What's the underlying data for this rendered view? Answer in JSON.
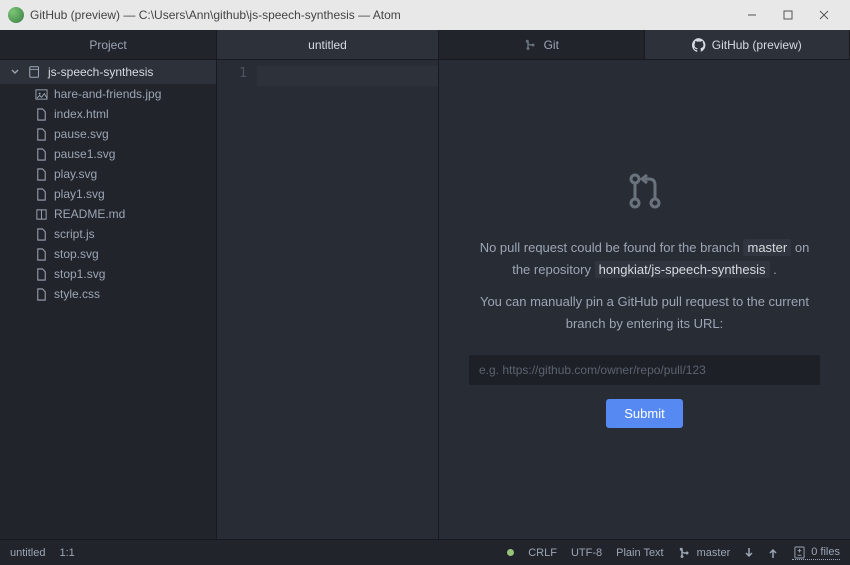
{
  "window": {
    "title": "GitHub (preview) — C:\\Users\\Ann\\github\\js-speech-synthesis — Atom"
  },
  "panelTabs": {
    "project": "Project",
    "untitled": "untitled",
    "git": "Git",
    "github": "GitHub (preview)"
  },
  "tree": {
    "root": "js-speech-synthesis",
    "files": [
      {
        "name": "hare-and-friends.jpg",
        "icon": "image"
      },
      {
        "name": "index.html",
        "icon": "file"
      },
      {
        "name": "pause.svg",
        "icon": "file"
      },
      {
        "name": "pause1.svg",
        "icon": "file"
      },
      {
        "name": "play.svg",
        "icon": "file"
      },
      {
        "name": "play1.svg",
        "icon": "file"
      },
      {
        "name": "README.md",
        "icon": "book"
      },
      {
        "name": "script.js",
        "icon": "file"
      },
      {
        "name": "stop.svg",
        "icon": "file"
      },
      {
        "name": "stop1.svg",
        "icon": "file"
      },
      {
        "name": "style.css",
        "icon": "file"
      }
    ]
  },
  "editor": {
    "line1": "1"
  },
  "github": {
    "msg1_pre": "No pull request could be found for the branch ",
    "branch": "master",
    "msg1_mid": " on the repository ",
    "repo": "hongkiat/js-speech-synthesis",
    "msg1_post": " .",
    "msg2": "You can manually pin a GitHub pull request to the current branch by entering its URL:",
    "placeholder": "e.g. https://github.com/owner/repo/pull/123",
    "submit": "Submit"
  },
  "status": {
    "file": "untitled",
    "pos": "1:1",
    "eol": "CRLF",
    "encoding": "UTF-8",
    "grammar": "Plain Text",
    "branch": "master",
    "files": "0 files"
  }
}
